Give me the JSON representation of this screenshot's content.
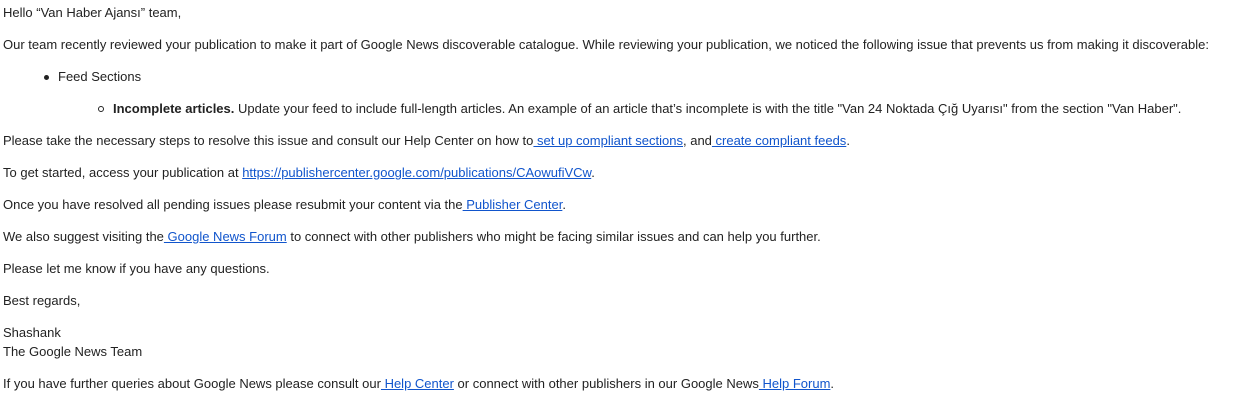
{
  "greeting": "Hello “Van Haber Ajansı” team,",
  "intro": "Our team recently reviewed your publication to make it part of Google News discoverable catalogue. While reviewing your publication, we noticed the following issue that prevents us from making it discoverable:",
  "issue_list": {
    "section": "Feed Sections",
    "issue_title": "Incomplete articles.",
    "issue_text": " Update your feed to include full-length articles. An example of an article that’s incomplete is with the title \"Van 24 Noktada Çığ Uyarısı\" from the section \"Van Haber\"."
  },
  "steps": {
    "text_before": "Please take the necessary steps to resolve this issue and consult our Help Center on how to",
    "link1": " set up compliant sections",
    "text_mid": ", and",
    "link2": " create compliant feeds",
    "text_after": "."
  },
  "get_started": {
    "text_before": "To get started, access your publication at ",
    "link": "https://publishercenter.google.com/publications/CAowufiVCw",
    "text_after": "."
  },
  "resubmit": {
    "text_before": "Once you have resolved all pending issues please resubmit your content via the",
    "link": " Publisher Center",
    "text_after": "."
  },
  "forum": {
    "text_before": "We also suggest visiting the",
    "link": " Google News Forum",
    "text_after": " to connect with other publishers who might be facing similar issues and can help you further."
  },
  "questions": "Please let me know if you have any questions.",
  "regards": "Best regards,",
  "signature": {
    "name": "Shashank",
    "team": "The Google News Team"
  },
  "footer": {
    "text_before": "If you have further queries about Google News please consult our",
    "link1": " Help Center",
    "text_mid": " or connect with other publishers in our Google News",
    "link2": " Help Forum",
    "text_after": "."
  },
  "colors": {
    "text": "#222222",
    "link": "#1155cc",
    "background": "#ffffff"
  }
}
